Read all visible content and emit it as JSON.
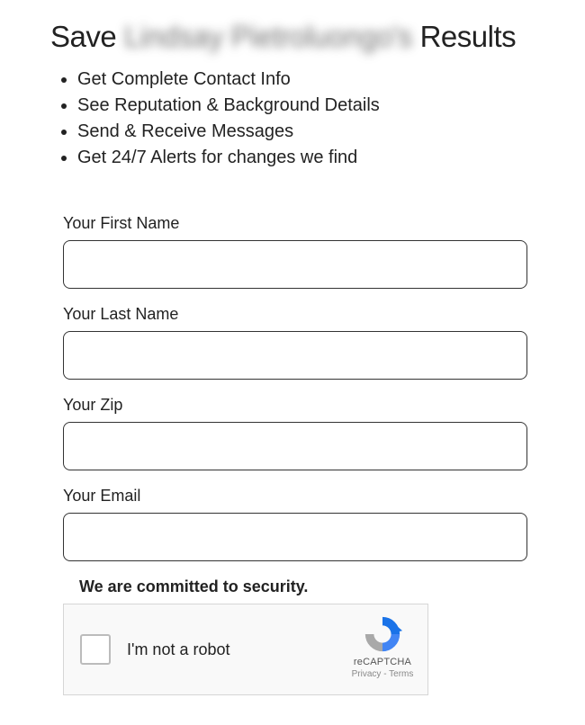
{
  "heading": {
    "prefix": "Save",
    "name": "Lindsay Pietroluongo's",
    "suffix": "Results"
  },
  "bullets": [
    "Get Complete Contact Info",
    "See Reputation & Background Details",
    "Send & Receive Messages",
    "Get 24/7 Alerts for changes we find"
  ],
  "fields": {
    "firstName": {
      "label": "Your First Name",
      "value": ""
    },
    "lastName": {
      "label": "Your Last Name",
      "value": ""
    },
    "zip": {
      "label": "Your Zip",
      "value": ""
    },
    "email": {
      "label": "Your Email",
      "value": ""
    }
  },
  "securityNote": "We are committed to security.",
  "recaptcha": {
    "label": "I'm not a robot",
    "brand": "reCAPTCHA",
    "privacy": "Privacy",
    "terms": "Terms"
  }
}
